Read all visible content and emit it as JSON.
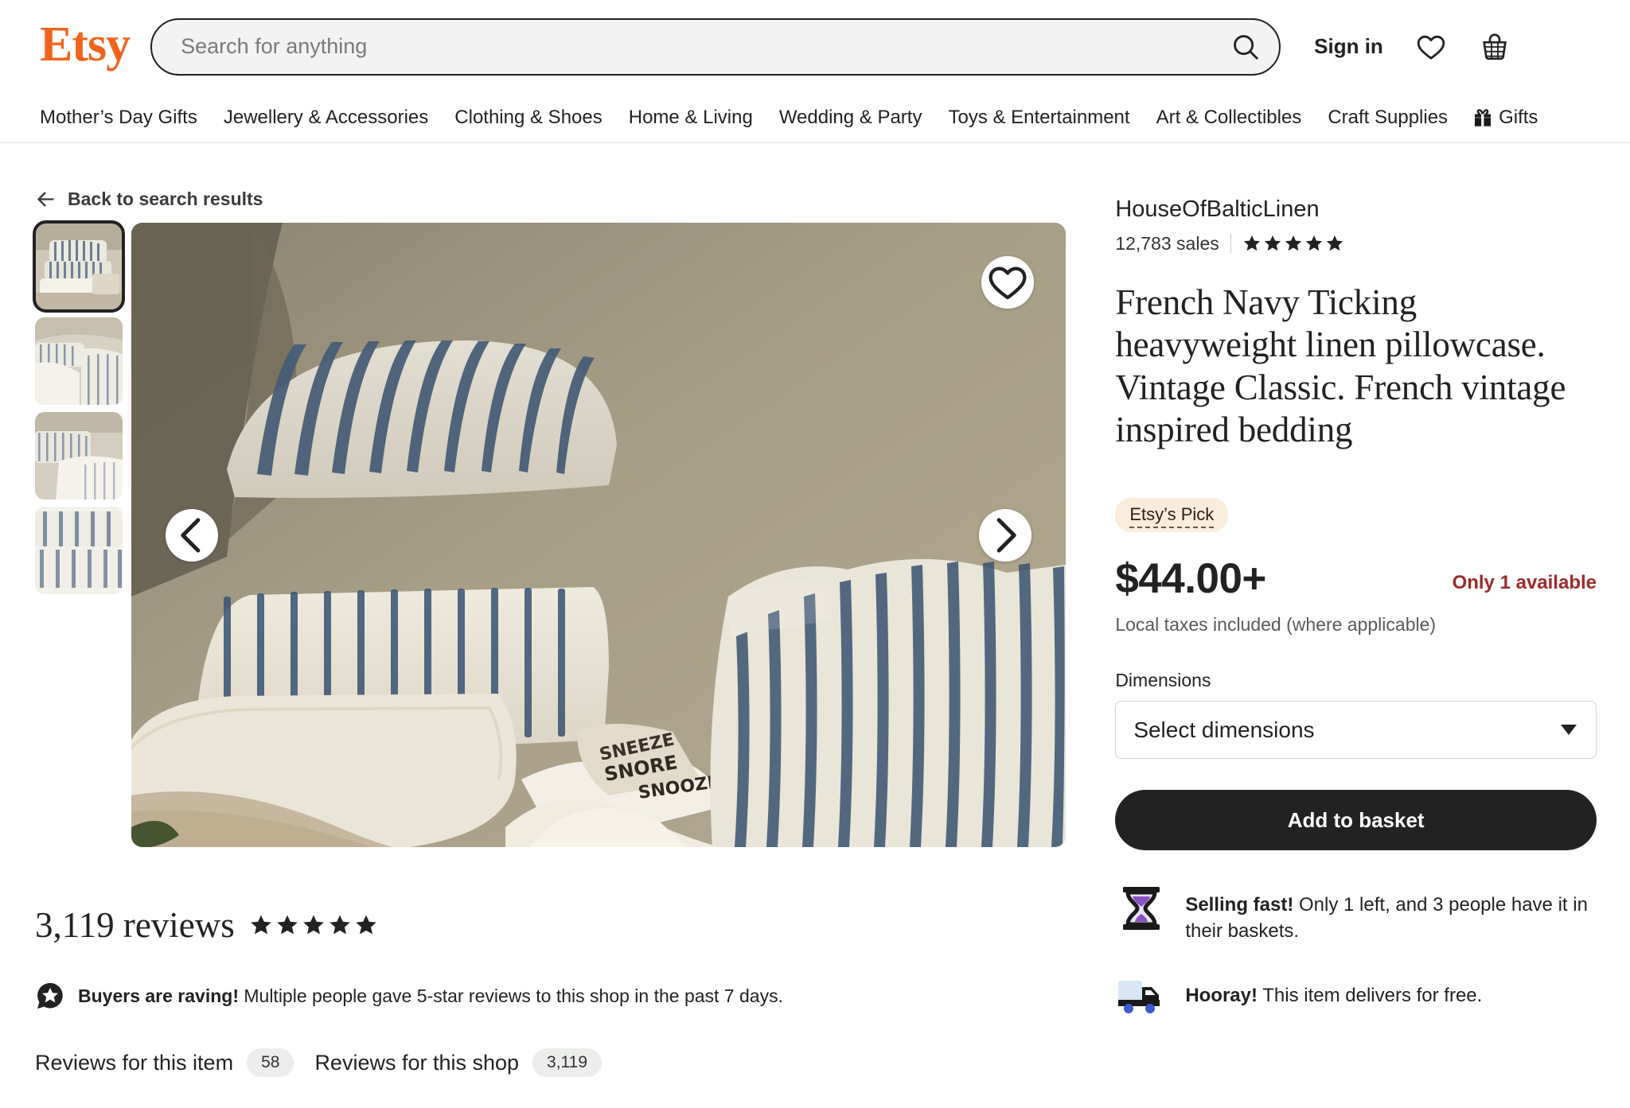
{
  "header": {
    "logo": "Etsy",
    "search": {
      "placeholder": "Search for anything",
      "value": ""
    },
    "search_icon": "search-icon",
    "sign_in": "Sign in",
    "favourites_icon": "heart-icon",
    "basket_icon": "basket-icon"
  },
  "nav": {
    "items": [
      {
        "label": "Mother’s Day Gifts"
      },
      {
        "label": "Jewellery & Accessories"
      },
      {
        "label": "Clothing & Shoes"
      },
      {
        "label": "Home & Living"
      },
      {
        "label": "Wedding & Party"
      },
      {
        "label": "Toys & Entertainment"
      },
      {
        "label": "Art & Collectibles"
      },
      {
        "label": "Craft Supplies"
      },
      {
        "label": "Gifts",
        "icon": "gift-icon"
      }
    ]
  },
  "back_link": {
    "label": "Back to search results",
    "icon": "arrow-left-icon"
  },
  "gallery": {
    "thumbnails": [
      {
        "alt": "Stacked striped linen pillowcases",
        "selected": true
      },
      {
        "alt": "Striped linen bedding draped"
      },
      {
        "alt": "Striped pillow and white duvet"
      },
      {
        "alt": "Folded navy ticking stripe linen"
      }
    ],
    "main_image_alt": "Navy ticking stripe linen pillowcases stacked on a bed with an open book",
    "favourite_icon": "heart-icon",
    "prev_icon": "chevron-left-icon",
    "next_icon": "chevron-right-icon"
  },
  "reviews": {
    "count_label": "3,119 reviews",
    "rating": 5,
    "badge_icon": "star-bubble-icon",
    "raving_bold": "Buyers are raving!",
    "raving_rest": "Multiple people gave 5-star reviews to this shop in the past 7 days.",
    "tabs": [
      {
        "label": "Reviews for this item",
        "count": "58"
      },
      {
        "label": "Reviews for this shop",
        "count": "3,119"
      }
    ]
  },
  "product": {
    "shop_name": "HouseOfBalticLinen",
    "sales": "12,783 sales",
    "shop_rating": 5,
    "title": "French Navy Ticking heavyweight linen pillowcase. Vintage Classic. French vintage inspired bedding",
    "badge": "Etsy’s Pick",
    "price": "$44.00+",
    "availability": "Only 1 available",
    "tax_note": "Local taxes included (where applicable)",
    "option_label": "Dimensions",
    "option_value": "Select dimensions",
    "cta": "Add to basket",
    "selling_fast_icon": "hourglass-icon",
    "selling_fast_bold": "Selling fast!",
    "selling_fast_rest": "Only 1 left, and 3 people have it in their baskets.",
    "delivery_icon": "truck-icon",
    "delivery_bold": "Hooray!",
    "delivery_rest": "This item delivers for free."
  },
  "colors": {
    "brand_orange": "#F1641E",
    "alert_red": "#9E2A2B",
    "badge_bg": "#FAEDDB",
    "cta_bg": "#222222"
  }
}
